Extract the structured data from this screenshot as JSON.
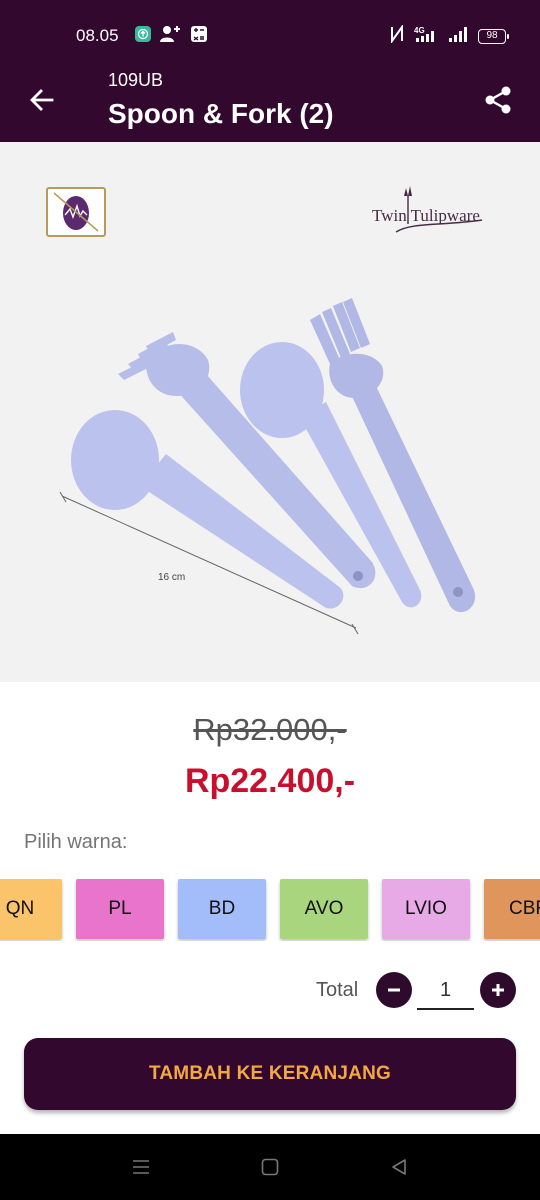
{
  "status_bar": {
    "time": "08.05",
    "network": "4G",
    "battery": "98"
  },
  "app_bar": {
    "code": "109UB",
    "title": "Spoon & Fork (2)"
  },
  "product_image": {
    "brand": "Twin Tulipware",
    "dimension_label": "16 cm",
    "item_color": "#b7bde9"
  },
  "pricing": {
    "old_price": "Rp32.000,-",
    "new_price": "Rp22.400,-"
  },
  "color_picker": {
    "label": "Pilih warna:",
    "options": [
      {
        "code": "QN",
        "color": "#fbc46a"
      },
      {
        "code": "PL",
        "color": "#e874cc"
      },
      {
        "code": "BD",
        "color": "#a3bdfa"
      },
      {
        "code": "AVO",
        "color": "#a8d57e"
      },
      {
        "code": "LVIO",
        "color": "#e8aae6"
      },
      {
        "code": "CBR",
        "color": "#df955b"
      }
    ]
  },
  "quantity": {
    "label": "Total",
    "value": "1"
  },
  "actions": {
    "add_to_cart": "TAMBAH KE KERANJANG"
  },
  "colors": {
    "primary": "#33082f",
    "price_red": "#c8102e",
    "button_text": "#f4a842"
  }
}
